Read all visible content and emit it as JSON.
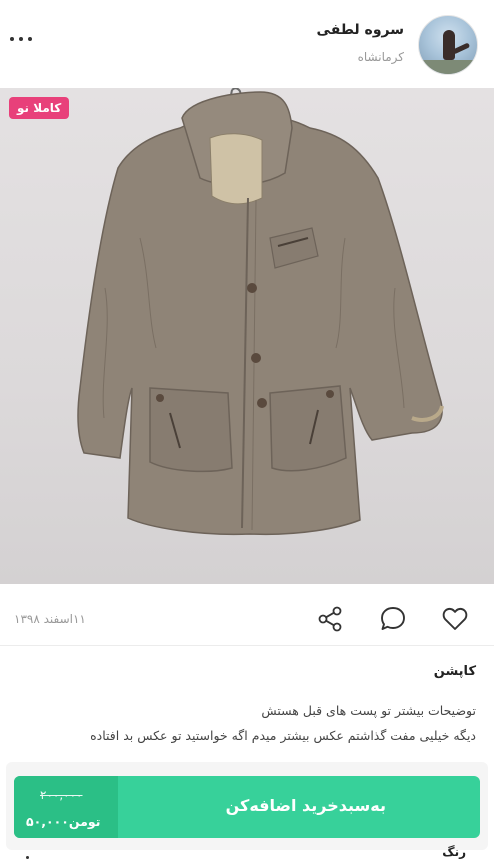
{
  "header": {
    "user_name": "سروه لطفی",
    "user_city": "کرمانشاه",
    "more_icon": "more-dots-icon"
  },
  "photo": {
    "badge": "کاملا نو",
    "badge_color": "#e8407a"
  },
  "actions": {
    "post_date": "۱۱اسفند ۱۳۹۸",
    "icons": [
      "share-icon",
      "comment-icon",
      "heart-icon"
    ]
  },
  "post": {
    "title": "کاپشن",
    "desc_line1": "توضیحات بیشتر تو پست های قبل هستش",
    "desc_line2": "دیگه خیلیی مفت گذاشتم عکس بیشتر میدم اگه خواستید تو عکس بد افتاده"
  },
  "cart": {
    "old_price": "۲۰۰,۰۰۰",
    "new_price": "۵۰,۰۰۰",
    "currency": "تومن",
    "label": "به‌سبدخرید اضافه‌کن",
    "accent": "#37d19a"
  },
  "options": {
    "color_label": "رنگ"
  }
}
